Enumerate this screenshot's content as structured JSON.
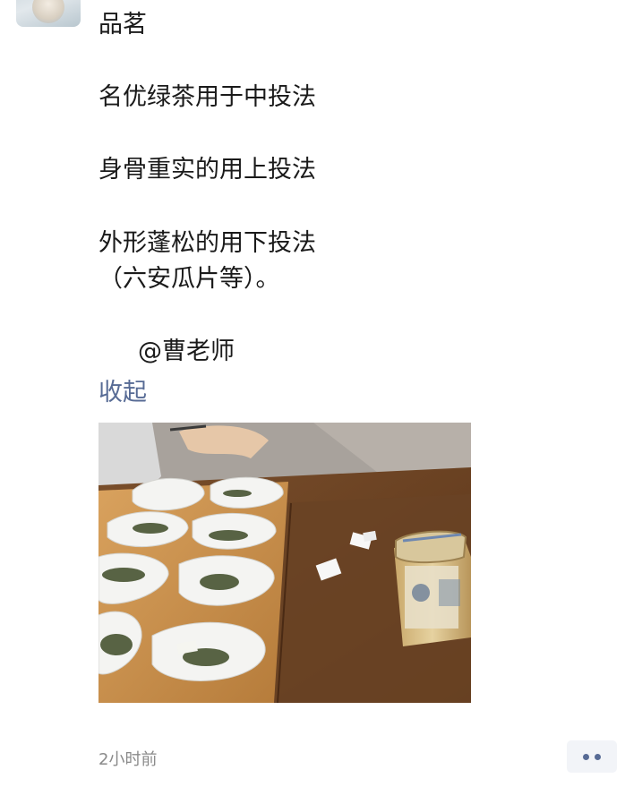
{
  "post": {
    "lines": [
      "品茗",
      "名优绿茶用于中投法",
      "身骨重实的用上投法",
      "外形蓬松的用下投法",
      "（六安瓜片等）。",
      "@曹老师"
    ],
    "collapse_label": "收起",
    "timestamp": "2小时前"
  },
  "icons": {
    "more": "more-dots-icon",
    "avatar": "user-avatar"
  },
  "colors": {
    "link": "#576b95",
    "text": "#1a1a1a",
    "meta": "#8a8a8a"
  }
}
